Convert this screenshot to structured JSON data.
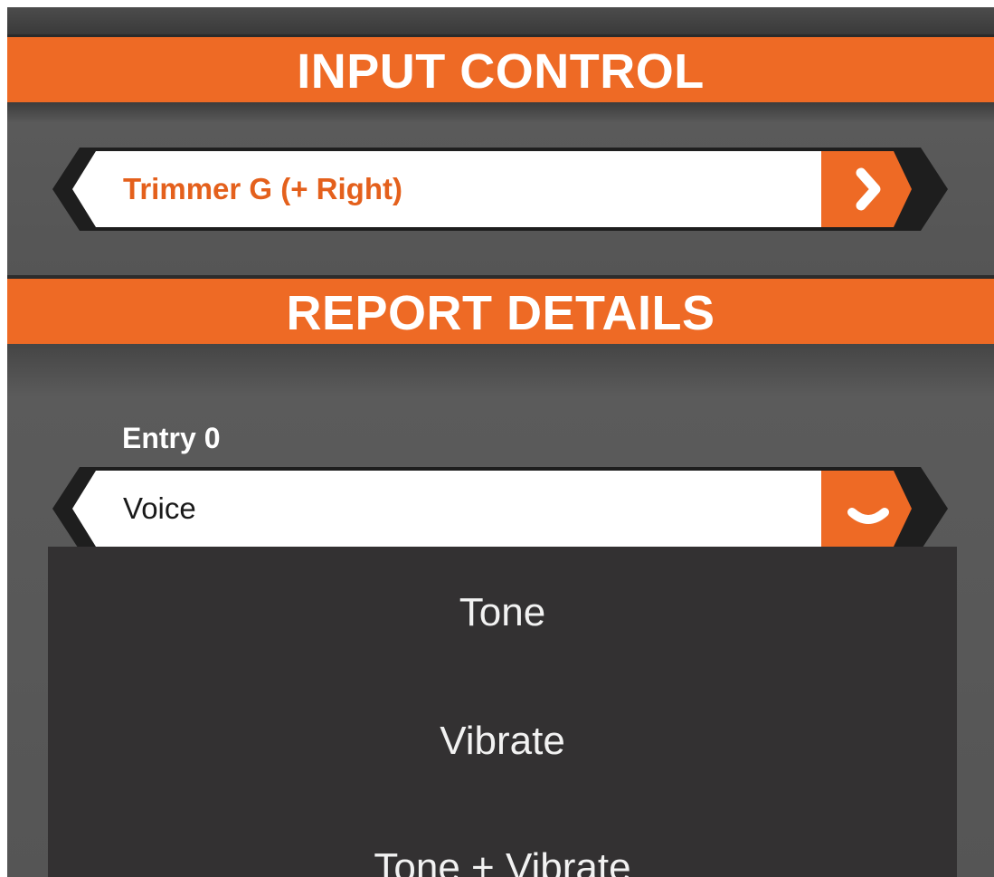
{
  "sections": {
    "input_control": {
      "title": "INPUT CONTROL"
    },
    "report_details": {
      "title": "REPORT DETAILS"
    }
  },
  "input_selector": {
    "value": "Trimmer G (+ Right)",
    "button_icon": "chevron-right-icon"
  },
  "entry": {
    "label": "Entry 0",
    "value": "Voice",
    "button_icon": "chevron-down-icon",
    "options": [
      "Tone",
      "Vibrate",
      "Tone + Vibrate"
    ]
  },
  "colors": {
    "accent": "#EE6A25",
    "background": "#555555",
    "dropdown_bg": "#333132",
    "field_bg": "#FFFFFF"
  }
}
